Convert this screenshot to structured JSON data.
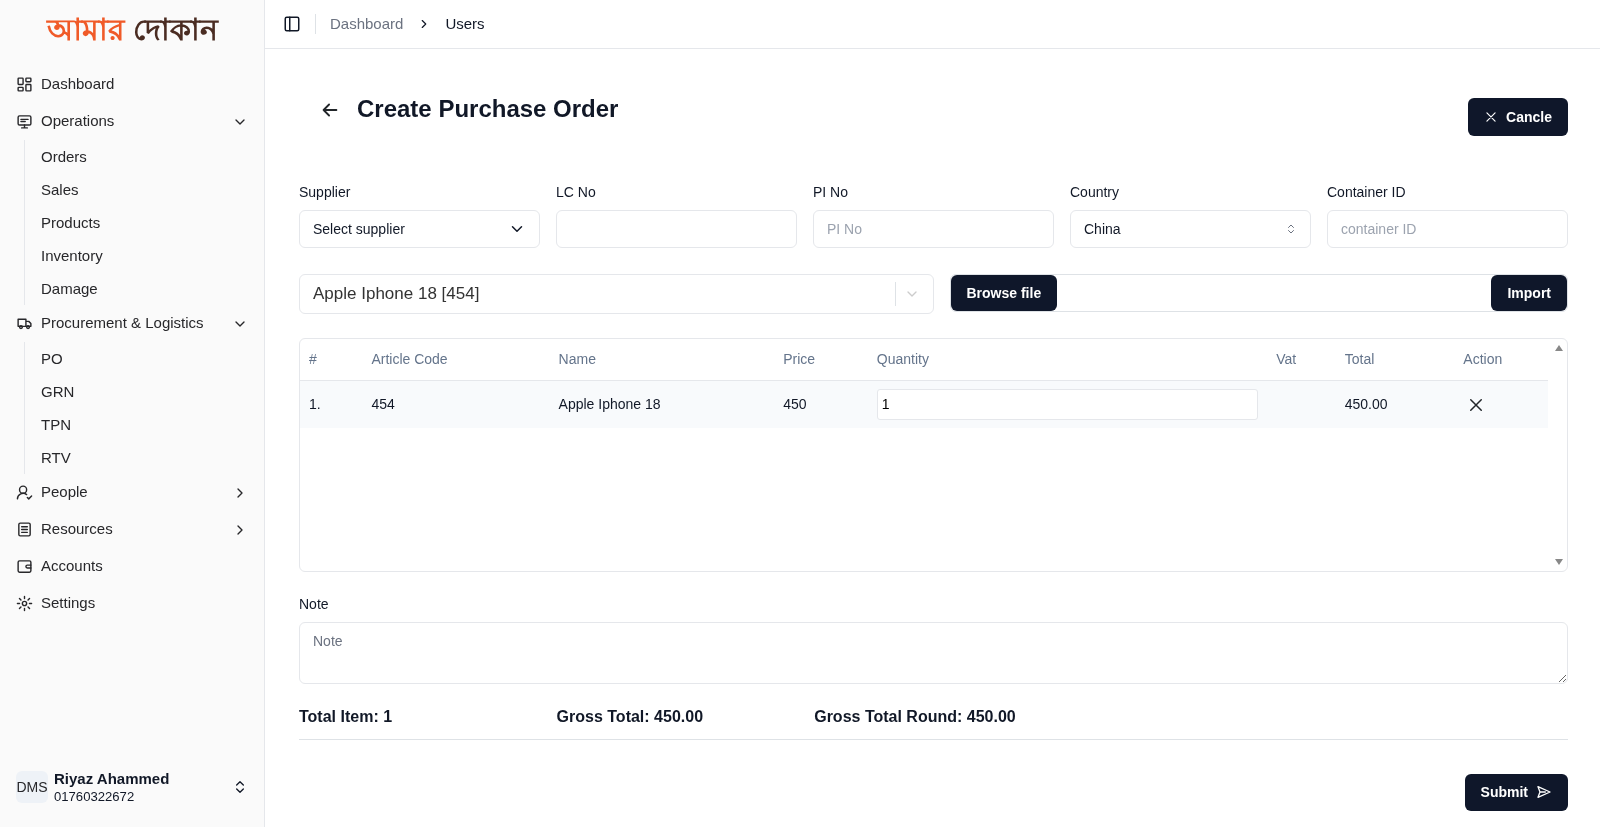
{
  "logo": {
    "part_1": "আমার",
    "part_2": "দোকান"
  },
  "sidebar": {
    "items": [
      {
        "kind": "link",
        "label": "Dashboard"
      },
      {
        "kind": "group",
        "label": "Operations",
        "expanded": true,
        "children": [
          {
            "label": "Orders"
          },
          {
            "label": "Sales"
          },
          {
            "label": "Products"
          },
          {
            "label": "Inventory"
          },
          {
            "label": "Damage"
          }
        ]
      },
      {
        "kind": "group",
        "label": "Procurement & Logistics",
        "expanded": true,
        "children": [
          {
            "label": "PO"
          },
          {
            "label": "GRN"
          },
          {
            "label": "TPN"
          },
          {
            "label": "RTV"
          }
        ]
      },
      {
        "kind": "group",
        "label": "People",
        "expanded": false
      },
      {
        "kind": "group",
        "label": "Resources",
        "expanded": false
      },
      {
        "kind": "link",
        "label": "Accounts"
      },
      {
        "kind": "link",
        "label": "Settings"
      }
    ]
  },
  "user": {
    "avatar": "DMS",
    "name": "Riyaz Ahammed",
    "phone": "01760322672"
  },
  "breadcrumb": [
    "Dashboard",
    "Users"
  ],
  "page_title": "Create Purchase Order",
  "cancel_button": "Cancle",
  "fields": [
    {
      "kind": "dropdown",
      "label": "Supplier",
      "value": "Select supplier"
    },
    {
      "kind": "input",
      "label": "LC No"
    },
    {
      "kind": "input",
      "label": "PI No",
      "placeholder": "PI No"
    },
    {
      "kind": "select",
      "label": "Country",
      "value": "China"
    },
    {
      "kind": "input",
      "label": "Container ID",
      "placeholder": "container ID"
    }
  ],
  "product_select": {
    "value": "Apple Iphone 18 [454]"
  },
  "browse_button": "Browse file",
  "import_button": "Import",
  "table": {
    "columns": [
      "#",
      "Article Code",
      "Name",
      "Price",
      "Quantity",
      "Vat",
      "Total",
      "Action"
    ],
    "rows": [
      {
        "index": "1.",
        "article_code": "454",
        "name": "Apple Iphone 18",
        "price": "450",
        "quantity": "1",
        "total": "450.00"
      }
    ]
  },
  "note": {
    "label": "Note",
    "placeholder": "Note"
  },
  "summary": [
    "Total Item: 1",
    "Gross Total: 450.00",
    "Gross Total Round: 450.00"
  ],
  "submit_button": "Submit"
}
